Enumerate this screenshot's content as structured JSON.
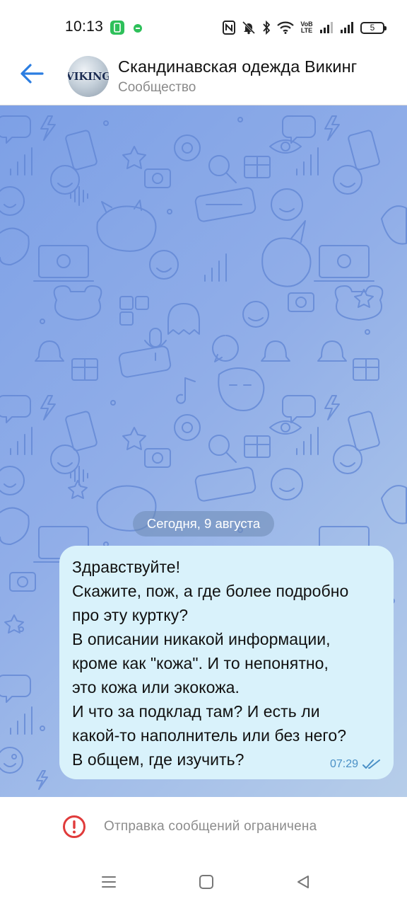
{
  "status_bar": {
    "time": "10:13",
    "network_label": "VoB LTE",
    "battery_level": "5"
  },
  "header": {
    "avatar_text": "VIKING",
    "title": "Скандинавская одежда Викинг",
    "subtitle": "Сообщество"
  },
  "chat": {
    "date_label": "Сегодня, 9 августа",
    "message": {
      "lines": [
        "Здравствуйте!",
        "Скажите, пож, а где более подробно",
        "про эту куртку?",
        "В описании никакой информации,",
        "кроме как \"кожа\". И то непонятно,",
        "это кожа или экокожа.",
        "И что за подклад там? И есть ли",
        "какой-то наполнитель или без него?",
        "В общем, где изучить?"
      ],
      "time": "07:29",
      "status_icon": "double-check-icon"
    }
  },
  "restriction": {
    "text": "Отправка сообщений ограничена",
    "icon": "alert-circle-icon",
    "icon_color": "#e03b3b"
  },
  "colors": {
    "accent": "#2b7de1",
    "bubble": "#d9f2fb",
    "chat_bg_start": "#7da0e6",
    "chat_bg_end": "#b6cde9",
    "time_text": "#4a90c6"
  }
}
